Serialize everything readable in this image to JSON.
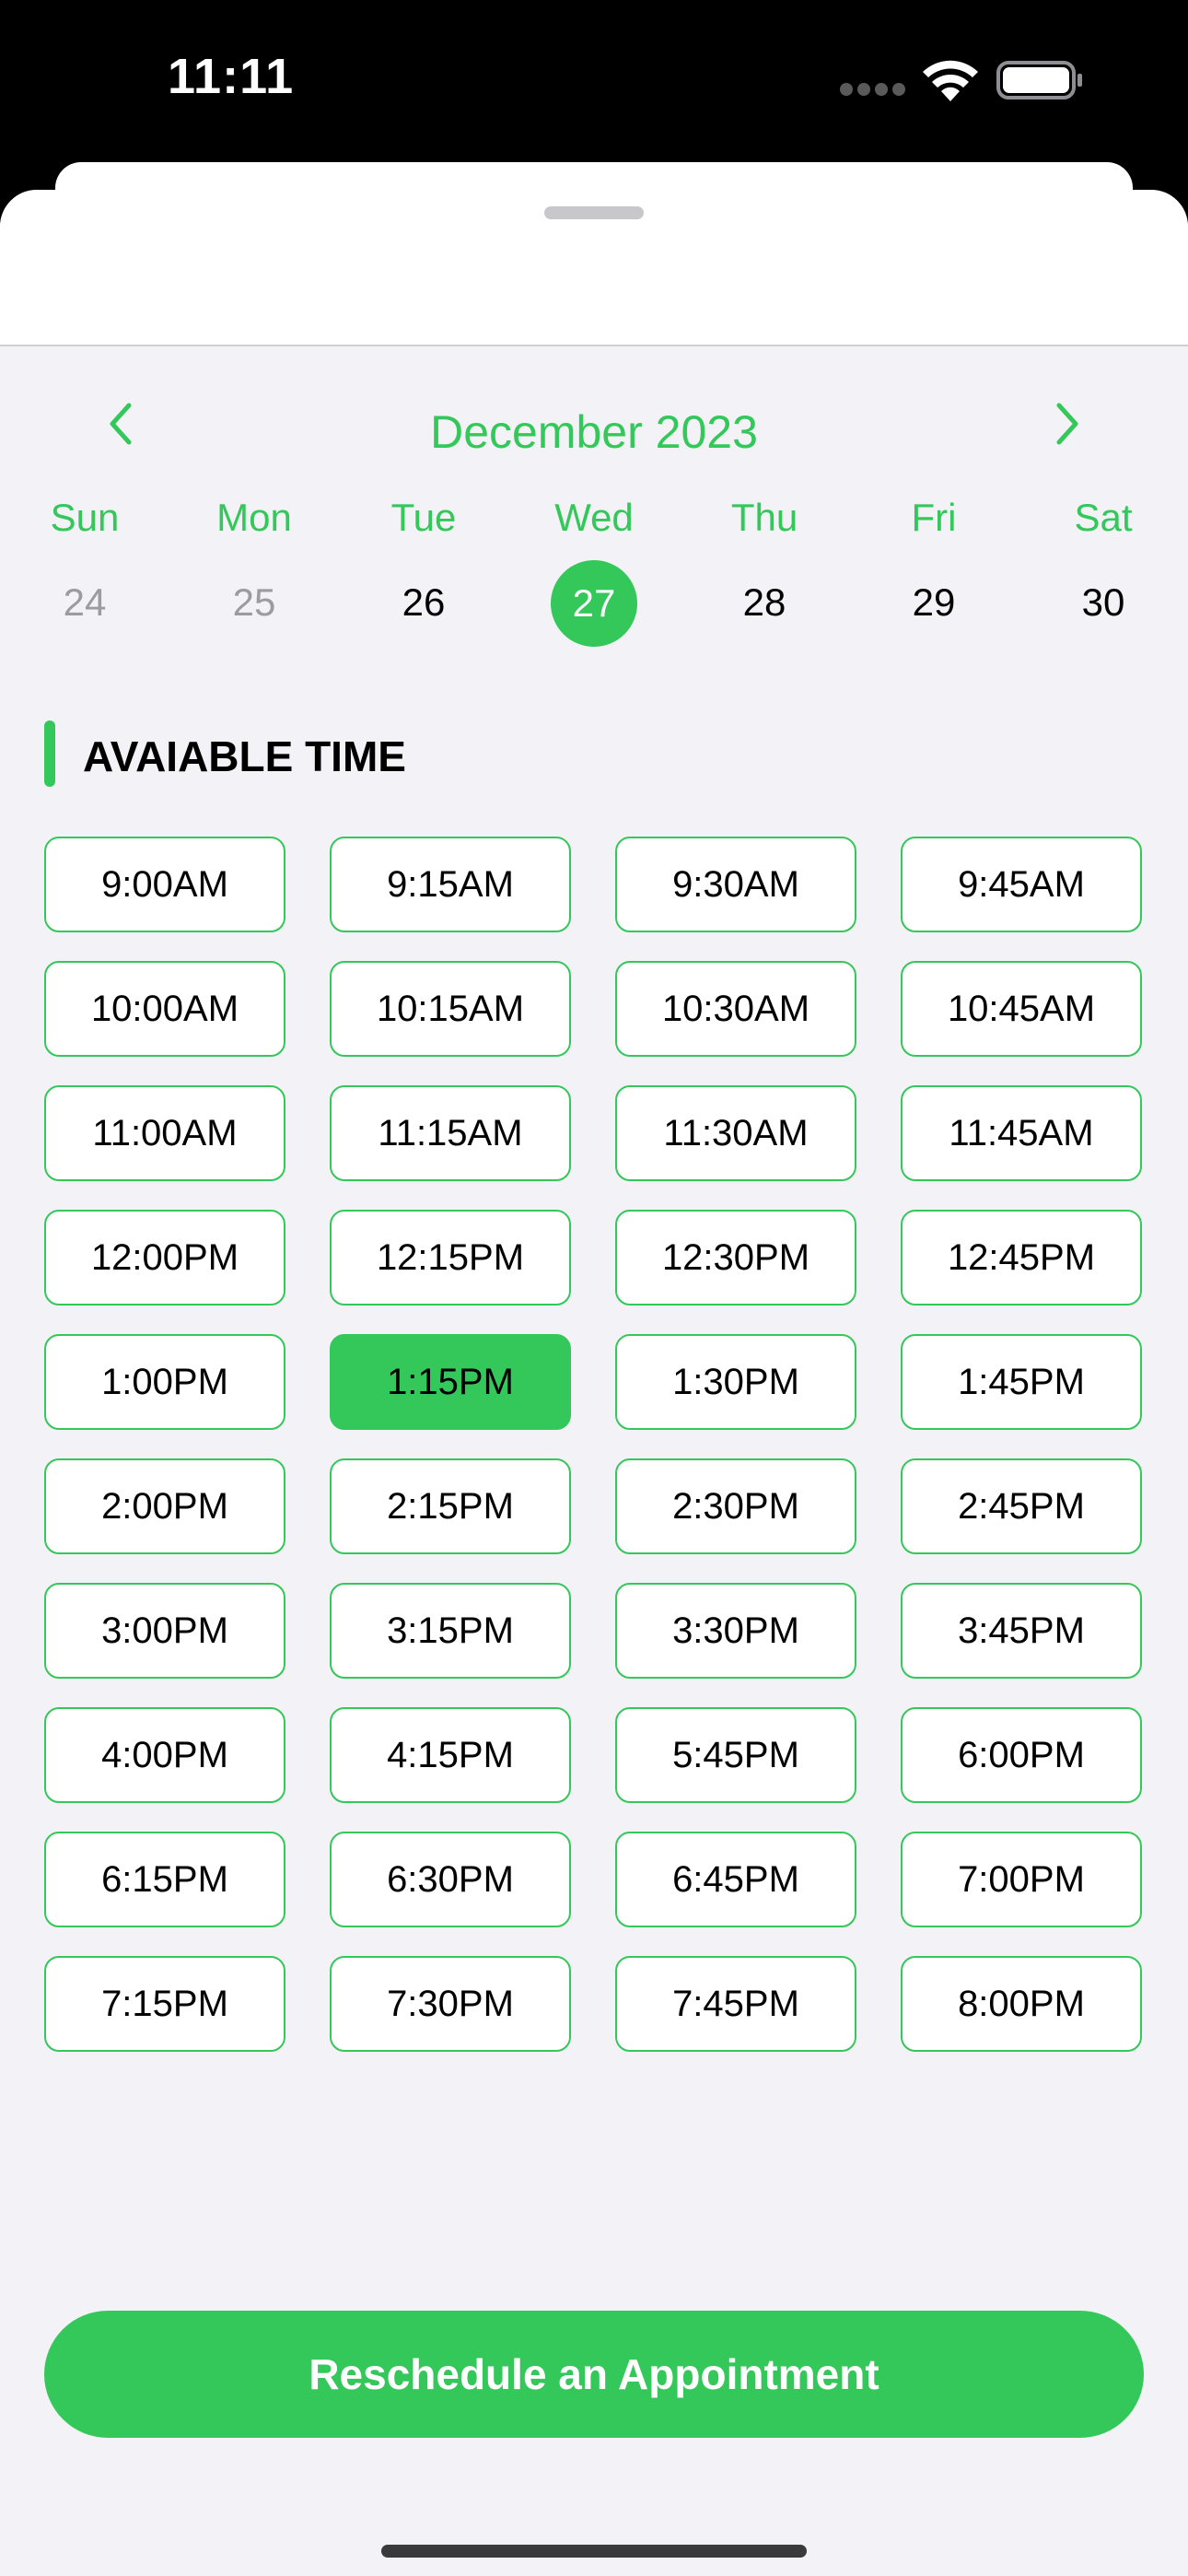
{
  "status_bar": {
    "time": "11:11"
  },
  "calendar": {
    "month_label": "December 2023",
    "weekdays": [
      "Sun",
      "Mon",
      "Tue",
      "Wed",
      "Thu",
      "Fri",
      "Sat"
    ],
    "days": [
      "24",
      "25",
      "26",
      "27",
      "28",
      "29",
      "30"
    ],
    "muted_days": [
      "24",
      "25"
    ],
    "selected_day": "27"
  },
  "section": {
    "title": "AVAIABLE TIME"
  },
  "time_slots": [
    "9:00AM",
    "9:15AM",
    "9:30AM",
    "9:45AM",
    "10:00AM",
    "10:15AM",
    "10:30AM",
    "10:45AM",
    "11:00AM",
    "11:15AM",
    "11:30AM",
    "11:45AM",
    "12:00PM",
    "12:15PM",
    "12:30PM",
    "12:45PM",
    "1:00PM",
    "1:15PM",
    "1:30PM",
    "1:45PM",
    "2:00PM",
    "2:15PM",
    "2:30PM",
    "2:45PM",
    "3:00PM",
    "3:15PM",
    "3:30PM",
    "3:45PM",
    "4:00PM",
    "4:15PM",
    "5:45PM",
    "6:00PM",
    "6:15PM",
    "6:30PM",
    "6:45PM",
    "7:00PM",
    "7:15PM",
    "7:30PM",
    "7:45PM",
    "8:00PM"
  ],
  "selected_slot": "1:15PM",
  "cta": {
    "label": "Reschedule an Appointment"
  },
  "colors": {
    "accent": "#34c759",
    "background": "#f2f2f7",
    "muted": "#9b9ba0"
  },
  "icons": {
    "prev": "chevron-left-icon",
    "next": "chevron-right-icon"
  }
}
